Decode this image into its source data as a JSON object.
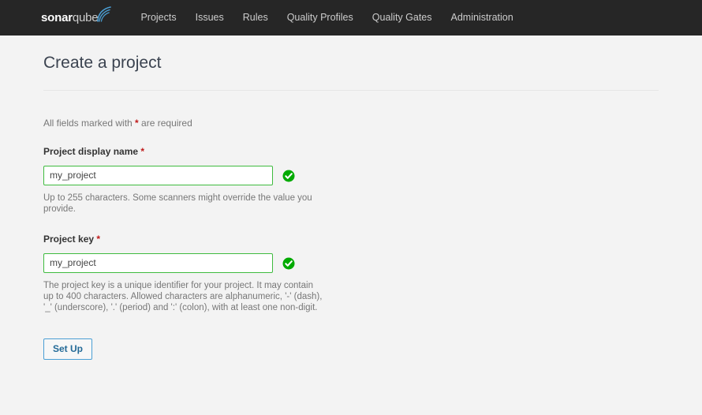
{
  "navbar": {
    "brand": {
      "name_bold": "sonar",
      "name_light": "qube",
      "wave_color": "#4b9fd5"
    },
    "links": [
      {
        "label": "Projects",
        "name": "nav-item-projects"
      },
      {
        "label": "Issues",
        "name": "nav-item-issues"
      },
      {
        "label": "Rules",
        "name": "nav-item-rules"
      },
      {
        "label": "Quality Profiles",
        "name": "nav-item-quality-profiles"
      },
      {
        "label": "Quality Gates",
        "name": "nav-item-quality-gates"
      },
      {
        "label": "Administration",
        "name": "nav-item-administration"
      }
    ],
    "background_color": "#262626"
  },
  "page": {
    "title": "Create a project",
    "required_note_prefix": "All fields marked with ",
    "required_note_star": "*",
    "required_note_suffix": " are required"
  },
  "form": {
    "display_name": {
      "label": "Project display name ",
      "required_star": "*",
      "value": "my_project",
      "placeholder": "",
      "hint": "Up to 255 characters. Some scanners might override the value you provide.",
      "valid": true,
      "valid_icon": "check-circle-icon",
      "border_color": "#3fbb3f"
    },
    "project_key": {
      "label": "Project key ",
      "required_star": "*",
      "value": "my_project",
      "placeholder": "",
      "hint": "The project key is a unique identifier for your project. It may contain up to 400 characters. Allowed characters are alphanumeric, '-' (dash), '_' (underscore), '.' (period) and ':' (colon), with at least one non-digit.",
      "valid": true,
      "valid_icon": "check-circle-icon",
      "border_color": "#3fbb3f"
    },
    "submit_label": "Set Up"
  },
  "colors": {
    "page_background": "#f3f3f3",
    "navbar": "#262626",
    "accent_blue": "#4b9fd5",
    "success_green": "#3fbb3f",
    "required_red": "#bf1a1a",
    "title_text": "#3b4350"
  }
}
